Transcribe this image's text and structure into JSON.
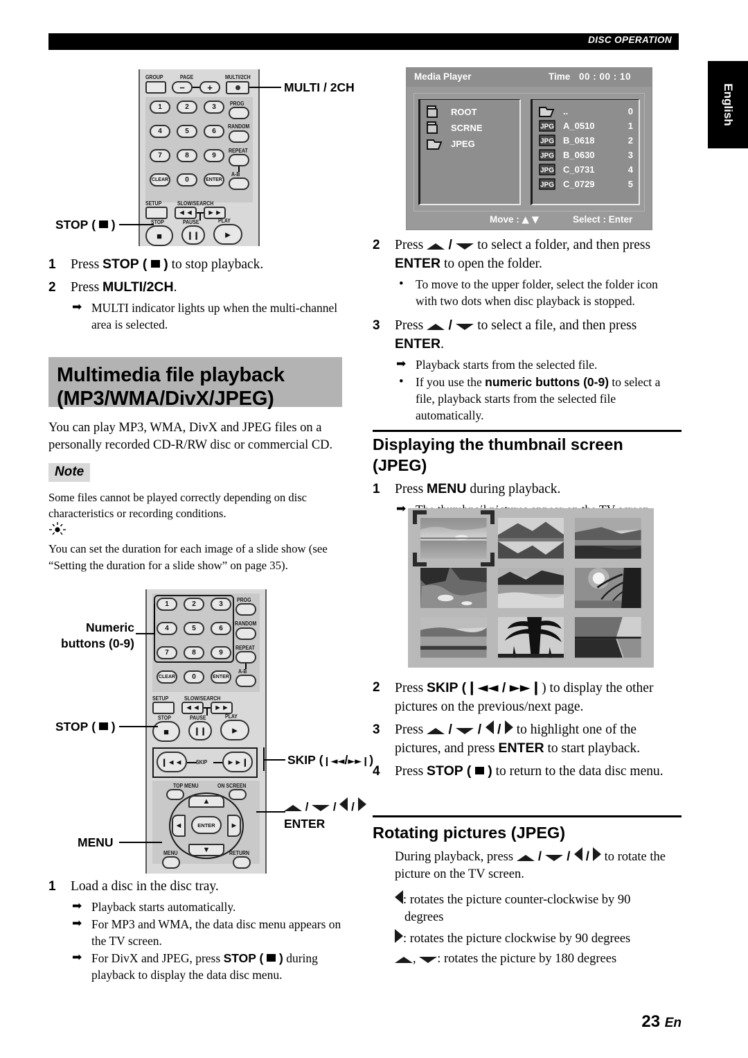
{
  "header": {
    "running_head": "DISC OPERATION",
    "lang_tab": "English"
  },
  "footer": {
    "page_number": "23",
    "page_suffix": "En"
  },
  "remote_top": {
    "callouts": [
      {
        "name": "multi-2ch",
        "label": "MULTI / 2CH"
      },
      {
        "name": "stop",
        "label": "STOP (  )"
      }
    ],
    "button_labels": [
      "GROUP",
      "PAGE",
      "MULTI/2CH",
      "PROG",
      "RANDOM",
      "REPEAT",
      "A-B",
      "SETUP",
      "SLOW/SEARCH",
      "STOP",
      "PAUSE",
      "PLAY"
    ],
    "keys": [
      "1",
      "2",
      "3",
      "4",
      "5",
      "6",
      "7",
      "8",
      "9",
      "CLEAR",
      "0",
      "ENTER"
    ],
    "pm": [
      "–",
      "+"
    ]
  },
  "remote_bottom": {
    "callouts": [
      {
        "name": "numeric-buttons",
        "line1": "Numeric",
        "line2": "buttons (0-9)"
      },
      {
        "name": "stop",
        "label": "STOP (  )"
      },
      {
        "name": "skip",
        "label": "SKIP (     /     )"
      },
      {
        "name": "cursor-enter",
        "line1": "  /   /   /  ",
        "line2": "ENTER"
      },
      {
        "name": "menu",
        "label": "MENU"
      }
    ],
    "button_labels": [
      "PROG",
      "RANDOM",
      "REPEAT",
      "A-B",
      "SETUP",
      "SLOW/SEARCH",
      "STOP",
      "PAUSE",
      "PLAY",
      "SKIP",
      "TOP MENU",
      "ON SCREEN",
      "MENU",
      "RETURN",
      "ENTER"
    ],
    "keys": [
      "1",
      "2",
      "3",
      "4",
      "5",
      "6",
      "7",
      "8",
      "9",
      "CLEAR",
      "0",
      "ENTER"
    ]
  },
  "left_column": {
    "step1": {
      "num": "1",
      "pre": "Press ",
      "bold": "STOP (",
      "post": ") to stop playback."
    },
    "step2": {
      "num": "2",
      "pre": "Press ",
      "bold": "MULTI/2CH",
      "post": "."
    },
    "step2_sub": "MULTI indicator lights up when the multi-channel area is selected.",
    "section_title_line1": "Multimedia file playback",
    "section_title_line2": "(MP3/WMA/DivX/JPEG)",
    "intro": "You can play MP3, WMA, DivX and JPEG files on a personally recorded CD-R/RW disc or commercial CD.",
    "note_badge": "Note",
    "note_text": "Some files cannot be played correctly depending on disc characteristics or recording conditions.",
    "tip_text": "You can set the duration for each image of a slide show (see “Setting the duration for a slide show” on page 35).",
    "load_step": {
      "num": "1",
      "text": "Load a disc in the disc tray."
    },
    "load_subs": [
      "Playback starts automatically.",
      "For MP3 and WMA, the data disc menu appears on the TV screen.",
      "For DivX and JPEG, press STOP (  ) during playback to display the data disc menu."
    ],
    "load_sub3_pre": "For DivX and JPEG, press ",
    "load_sub3_bold": "STOP (",
    "load_sub3_post": ") during playback to display the data disc menu."
  },
  "osd": {
    "title": "Media Player",
    "time_label": "Time",
    "time_value": "00 : 00 : 10",
    "folders": [
      {
        "icon": "folder-closed-icon",
        "name": "ROOT"
      },
      {
        "icon": "folder-closed-icon",
        "name": "SCRNE"
      },
      {
        "icon": "folder-open-icon",
        "name": "JPEG"
      }
    ],
    "files": [
      {
        "icon": "folder-open-icon",
        "name": "..",
        "index": "0"
      },
      {
        "icon": "jpg-icon",
        "name": "A_0510",
        "index": "1"
      },
      {
        "icon": "jpg-icon",
        "name": "B_0618",
        "index": "2"
      },
      {
        "icon": "jpg-icon",
        "name": "B_0630",
        "index": "3"
      },
      {
        "icon": "jpg-icon",
        "name": "C_0731",
        "index": "4"
      },
      {
        "icon": "jpg-icon",
        "name": "C_0729",
        "index": "5"
      }
    ],
    "jpg_badge": "JPG",
    "move_hint": "Move :",
    "select_hint": "Select : Enter"
  },
  "right_column": {
    "step2": {
      "num": "2",
      "pre": "Press ",
      "mid": " to select a folder, and then press ",
      "bold": "ENTER",
      "post": " to open the folder."
    },
    "step2_sub": "To move to the upper folder, select the folder icon with two dots when disc playback is stopped.",
    "step3": {
      "num": "3",
      "pre": "Press ",
      "mid": " to select a file, and then press ",
      "bold": "ENTER",
      "post": "."
    },
    "step3_sub1": "Playback starts from the selected file.",
    "step3_sub2_pre": "If you use the ",
    "step3_sub2_bold": "numeric buttons (0-9)",
    "step3_sub2_post": " to select a file, playback starts from the selected file automatically.",
    "thumb_heading": "Displaying the thumbnail screen (JPEG)",
    "thumb_step1": {
      "num": "1",
      "pre": "Press ",
      "bold": "MENU",
      "post": " during playback."
    },
    "thumb_step1_sub": "The thumbnail pictures appear on the TV screen.",
    "thumb_step2": {
      "num": "2",
      "pre": "Press ",
      "bold": "SKIP (",
      "mid": " / ",
      "post": ") to display the other pictures on the previous/next page."
    },
    "thumb_step3": {
      "num": "3",
      "pre": "Press ",
      "mid": " to highlight one of the pictures, and press ",
      "bold": "ENTER",
      "post": " to start playback."
    },
    "thumb_step4": {
      "num": "4",
      "pre": "Press ",
      "bold": "STOP (",
      "post": ") to return to the data disc menu."
    },
    "rotate_heading": "Rotating pictures (JPEG)",
    "rotate_intro_pre": "During playback, press ",
    "rotate_intro_post": " to rotate the picture on the TV screen.",
    "rotate_left": ": rotates the picture counter-clockwise by 90 degrees",
    "rotate_right": ": rotates the picture clockwise by 90 degrees",
    "rotate_updown": ": rotates the picture by 180 degrees"
  },
  "colors": {
    "banner_gray": "#b3b3b3",
    "note_gray": "#d8d8d8",
    "osd_gray": "#9a9a9a",
    "thumb_bg": "#b9b9b9",
    "black": "#000000"
  }
}
